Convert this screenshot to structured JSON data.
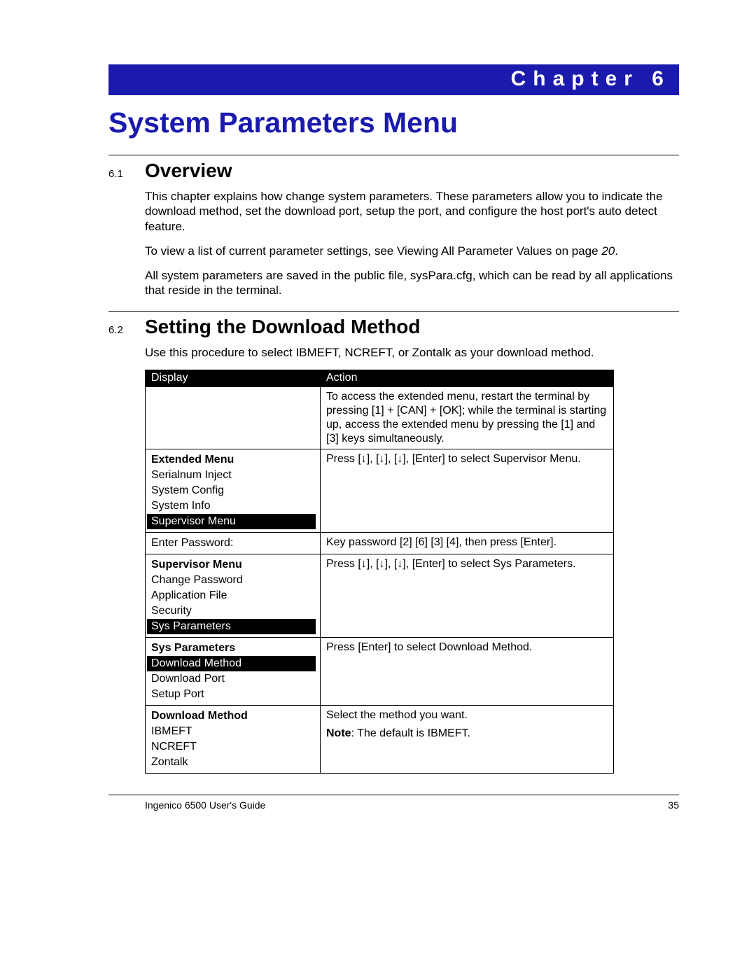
{
  "chapter": {
    "label": "Chapter 6",
    "title": "System Parameters Menu"
  },
  "sections": {
    "overview": {
      "num": "6.1",
      "title": "Overview",
      "p1": "This chapter explains how change system parameters. These parameters allow you to indicate the download method, set the download port, setup the port, and configure the host port's auto detect feature.",
      "p2_a": "To view a list of current parameter settings, see Viewing All Parameter Values on page ",
      "p2_pg": "20",
      "p2_b": ".",
      "p3": "All system parameters are saved in the public file, sysPara.cfg, which can be read by all applications that reside in the terminal."
    },
    "download": {
      "num": "6.2",
      "title": "Setting the Download Method",
      "intro": "Use this procedure to select IBMEFT, NCREFT, or Zontalk as your download method."
    }
  },
  "table": {
    "head_display": "Display",
    "head_action": "Action",
    "rows": [
      {
        "display": {
          "blank": true
        },
        "action": "To access the extended menu, restart the terminal by pressing [1] + [CAN] + [OK]; while the terminal is starting up, access the extended menu by pressing the [1] and [3] keys simultaneously."
      },
      {
        "display": {
          "title": "Extended Menu",
          "items": [
            {
              "t": "Serialnum Inject",
              "sel": false
            },
            {
              "t": "System Config",
              "sel": false
            },
            {
              "t": "System Info",
              "sel": false
            },
            {
              "t": "Supervisor Menu",
              "sel": true
            }
          ]
        },
        "action": "Press [↓], [↓], [↓], [Enter] to select Supervisor Menu."
      },
      {
        "display": {
          "items": [
            {
              "t": "Enter Password:",
              "sel": false
            }
          ]
        },
        "action": "Key password [2] [6] [3] [4], then press [Enter]."
      },
      {
        "display": {
          "title": "Supervisor Menu",
          "items": [
            {
              "t": "Change Password",
              "sel": false
            },
            {
              "t": "Application File",
              "sel": false
            },
            {
              "t": "Security",
              "sel": false
            },
            {
              "t": "Sys Parameters",
              "sel": true
            }
          ]
        },
        "action": "Press [↓], [↓], [↓], [Enter] to select Sys Parameters."
      },
      {
        "display": {
          "title": "Sys Parameters",
          "items": [
            {
              "t": "Download Method",
              "sel": true
            },
            {
              "t": "Download Port",
              "sel": false
            },
            {
              "t": "Setup Port",
              "sel": false
            }
          ]
        },
        "action": "Press [Enter] to select Download Method."
      },
      {
        "display": {
          "title": "Download Method",
          "items": [
            {
              "t": "IBMEFT",
              "sel": false
            },
            {
              "t": "NCREFT",
              "sel": false
            },
            {
              "t": "Zontalk",
              "sel": false
            }
          ]
        },
        "action_a": "Select the method you want.",
        "action_note_label": "Note",
        "action_note_rest": ": The default is IBMEFT."
      }
    ]
  },
  "footer": {
    "left": "Ingenico 6500 User's Guide",
    "right": "35"
  }
}
